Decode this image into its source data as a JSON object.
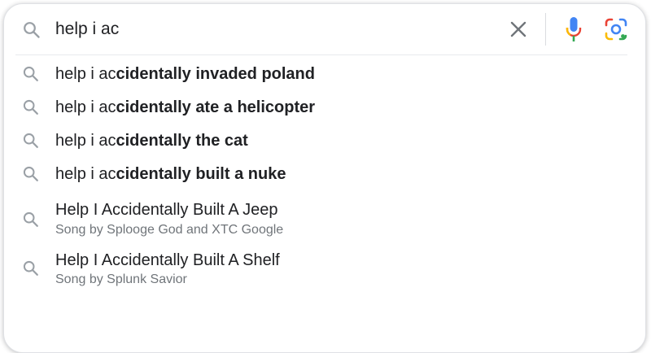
{
  "search": {
    "query": "help i ac"
  },
  "suggestions": [
    {
      "prefix": "help i ac",
      "completion": "cidentally invaded poland"
    },
    {
      "prefix": "help i ac",
      "completion": "cidentally ate a helicopter"
    },
    {
      "prefix": "help i ac",
      "completion": "cidentally the cat"
    },
    {
      "prefix": "help i ac",
      "completion": "cidentally built a nuke"
    }
  ],
  "rich_suggestions": [
    {
      "title": "Help I Accidentally Built A Jeep",
      "subtitle": "Song by Splooge God and XTC Google"
    },
    {
      "title": "Help I Accidentally Built A Shelf",
      "subtitle": "Song by Splunk Savior"
    }
  ],
  "icons": {
    "search": "search-icon",
    "clear": "close-icon",
    "voice": "microphone-icon",
    "lens": "google-lens-icon"
  },
  "colors": {
    "google_blue": "#4285f4",
    "google_red": "#ea4335",
    "google_yellow": "#fbbc04",
    "google_green": "#34a853",
    "suggestion_icon": "#9aa0a6"
  }
}
